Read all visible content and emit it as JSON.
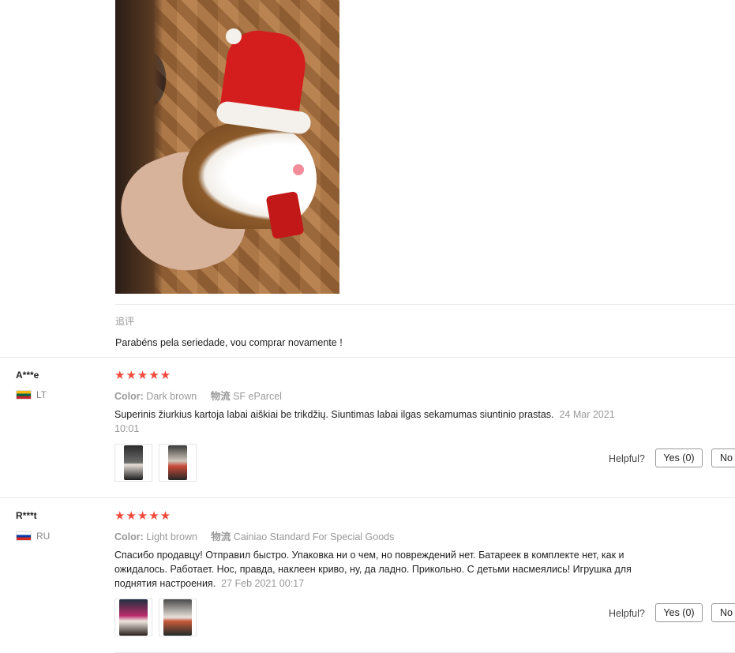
{
  "followup": {
    "label": "追评",
    "text": "Parabéns pela seriedade, vou comprar novamente !"
  },
  "reviews": [
    {
      "user": "A***e",
      "country": "LT",
      "stars": "★★★★★",
      "color_label": "Color:",
      "color_value": "Dark brown",
      "shipping_label": "物流",
      "shipping_value": "SF eParcel",
      "text": "Superinis žiurkius kartoja labai aiškiai be trikdžių. Siuntimas labai ilgas sekamumas siuntinio prastas.",
      "date_part1": "24 Mar 2021",
      "date_part2": "10:01",
      "helpful": "Helpful?",
      "yes": "Yes (0)",
      "no": "No"
    },
    {
      "user": "R***t",
      "country": "RU",
      "stars": "★★★★★",
      "color_label": "Color:",
      "color_value": "Light brown",
      "shipping_label": "物流",
      "shipping_value": "Cainiao Standard For Special Goods",
      "text_line1": "Спасибо продавцу! Отправил быстро. Упаковка ни о чем, но повреждений нет. Батареек в комплекте нет, как и",
      "text_line2": "ожидалось. Работает. Нос, правда, наклеен криво, ну, да ладно. Прикольно. С детьми насмеялись! Игрушка для",
      "text_line3": "поднятия настроения.",
      "date": "27 Feb 2021 00:17",
      "helpful": "Helpful?",
      "yes": "Yes (0)",
      "no": "No"
    }
  ],
  "colors": {
    "star": "#f04a3c",
    "muted": "#999999",
    "divider": "#e8e8e8"
  }
}
